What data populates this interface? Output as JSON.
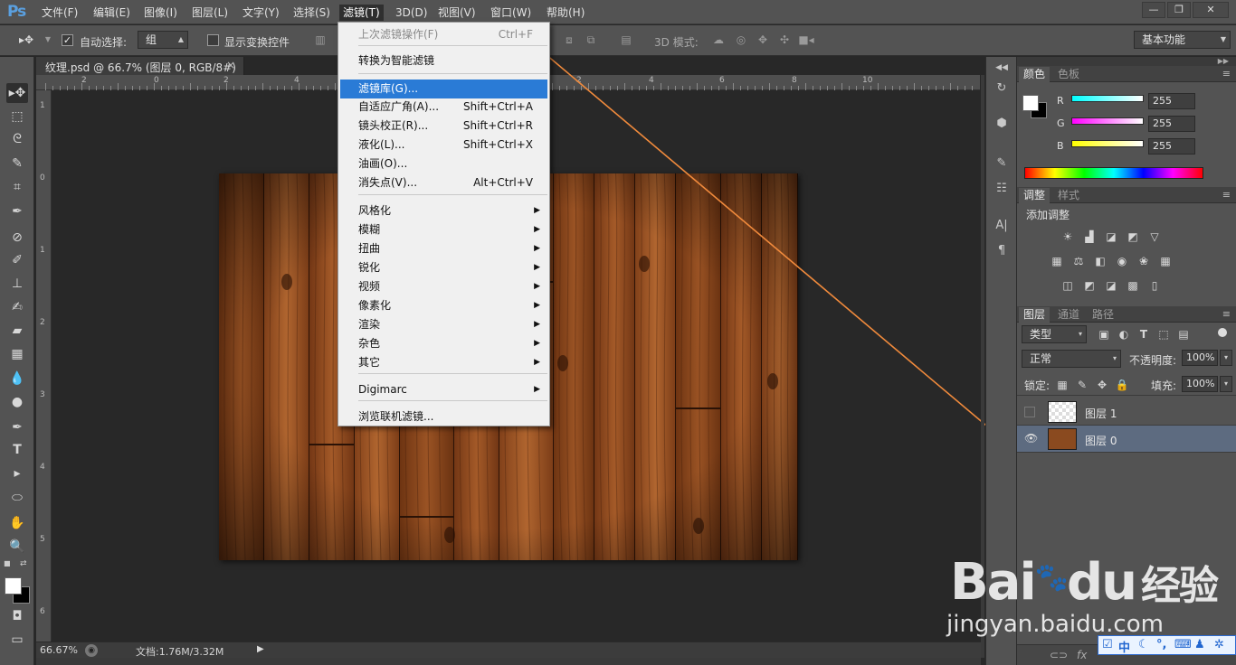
{
  "app": {
    "logo": "Ps",
    "menu": [
      "文件(F)",
      "编辑(E)",
      "图像(I)",
      "图层(L)",
      "文字(Y)",
      "选择(S)",
      "滤镜(T)",
      "3D(D)",
      "视图(V)",
      "窗口(W)",
      "帮助(H)"
    ],
    "window_buttons": [
      "—",
      "❐",
      "✕"
    ]
  },
  "options_bar": {
    "auto_select_label": "自动选择:",
    "auto_select_value": "组",
    "show_transform_label": "显示变换控件",
    "mode_3d_label": "3D 模式:",
    "workspace": "基本功能"
  },
  "document": {
    "tab_title": "纹理.psd @ 66.7% (图层 0, RGB/8#) *",
    "close": "×",
    "ruler_top_labels": [
      "2",
      "0",
      "2",
      "4",
      "6",
      "8",
      "10",
      "2",
      "4",
      "6",
      "8",
      "10"
    ],
    "ruler_left_labels": [
      "1",
      "0",
      "1",
      "2",
      "3",
      "4",
      "5",
      "6"
    ],
    "zoom": "66.67%",
    "doc_size": "文档:1.76M/3.32M"
  },
  "filter_menu": {
    "items": [
      {
        "label": "上次滤镜操作(F)",
        "shortcut": "Ctrl+F",
        "disabled": true
      },
      {
        "label": "转换为智能滤镜",
        "shortcut": ""
      },
      {
        "label": "滤镜库(G)...",
        "shortcut": "",
        "highlight": true
      },
      {
        "label": "自适应广角(A)...",
        "shortcut": "Shift+Ctrl+A"
      },
      {
        "label": "镜头校正(R)...",
        "shortcut": "Shift+Ctrl+R"
      },
      {
        "label": "液化(L)...",
        "shortcut": "Shift+Ctrl+X"
      },
      {
        "label": "油画(O)...",
        "shortcut": ""
      },
      {
        "label": "消失点(V)...",
        "shortcut": "Alt+Ctrl+V"
      },
      {
        "label": "风格化",
        "submenu": true
      },
      {
        "label": "模糊",
        "submenu": true
      },
      {
        "label": "扭曲",
        "submenu": true
      },
      {
        "label": "锐化",
        "submenu": true
      },
      {
        "label": "视频",
        "submenu": true
      },
      {
        "label": "像素化",
        "submenu": true
      },
      {
        "label": "渲染",
        "submenu": true
      },
      {
        "label": "杂色",
        "submenu": true
      },
      {
        "label": "其它",
        "submenu": true
      },
      {
        "label": "Digimarc",
        "submenu": true
      },
      {
        "label": "浏览联机滤镜...",
        "shortcut": ""
      }
    ]
  },
  "panels": {
    "color_tabs": [
      "颜色",
      "色板"
    ],
    "channels": [
      {
        "label": "R",
        "value": "255"
      },
      {
        "label": "G",
        "value": "255"
      },
      {
        "label": "B",
        "value": "255"
      }
    ],
    "adjust_tabs": [
      "调整",
      "样式"
    ],
    "add_adjustment": "添加调整",
    "layer_tabs": [
      "图层",
      "通道",
      "路径"
    ],
    "kind_filter": "类型",
    "blend_mode": "正常",
    "opacity_label": "不透明度:",
    "opacity_value": "100%",
    "lock_label": "锁定:",
    "fill_label": "填充:",
    "fill_value": "100%",
    "layers": [
      {
        "name": "图层 1",
        "visible": false
      },
      {
        "name": "图层 0",
        "visible": true,
        "selected": true
      }
    ]
  },
  "colors": {
    "accent": "#2a7bd6",
    "arrow": "#f08a3c",
    "highlight_box": "#e03030"
  },
  "watermark": {
    "brand": "Bai",
    "brand2": "du",
    "cn": "经验",
    "url": "jingyan.baidu.com"
  },
  "ime": [
    "中",
    "☾",
    "°,",
    "⌨",
    "♟",
    "✲"
  ]
}
